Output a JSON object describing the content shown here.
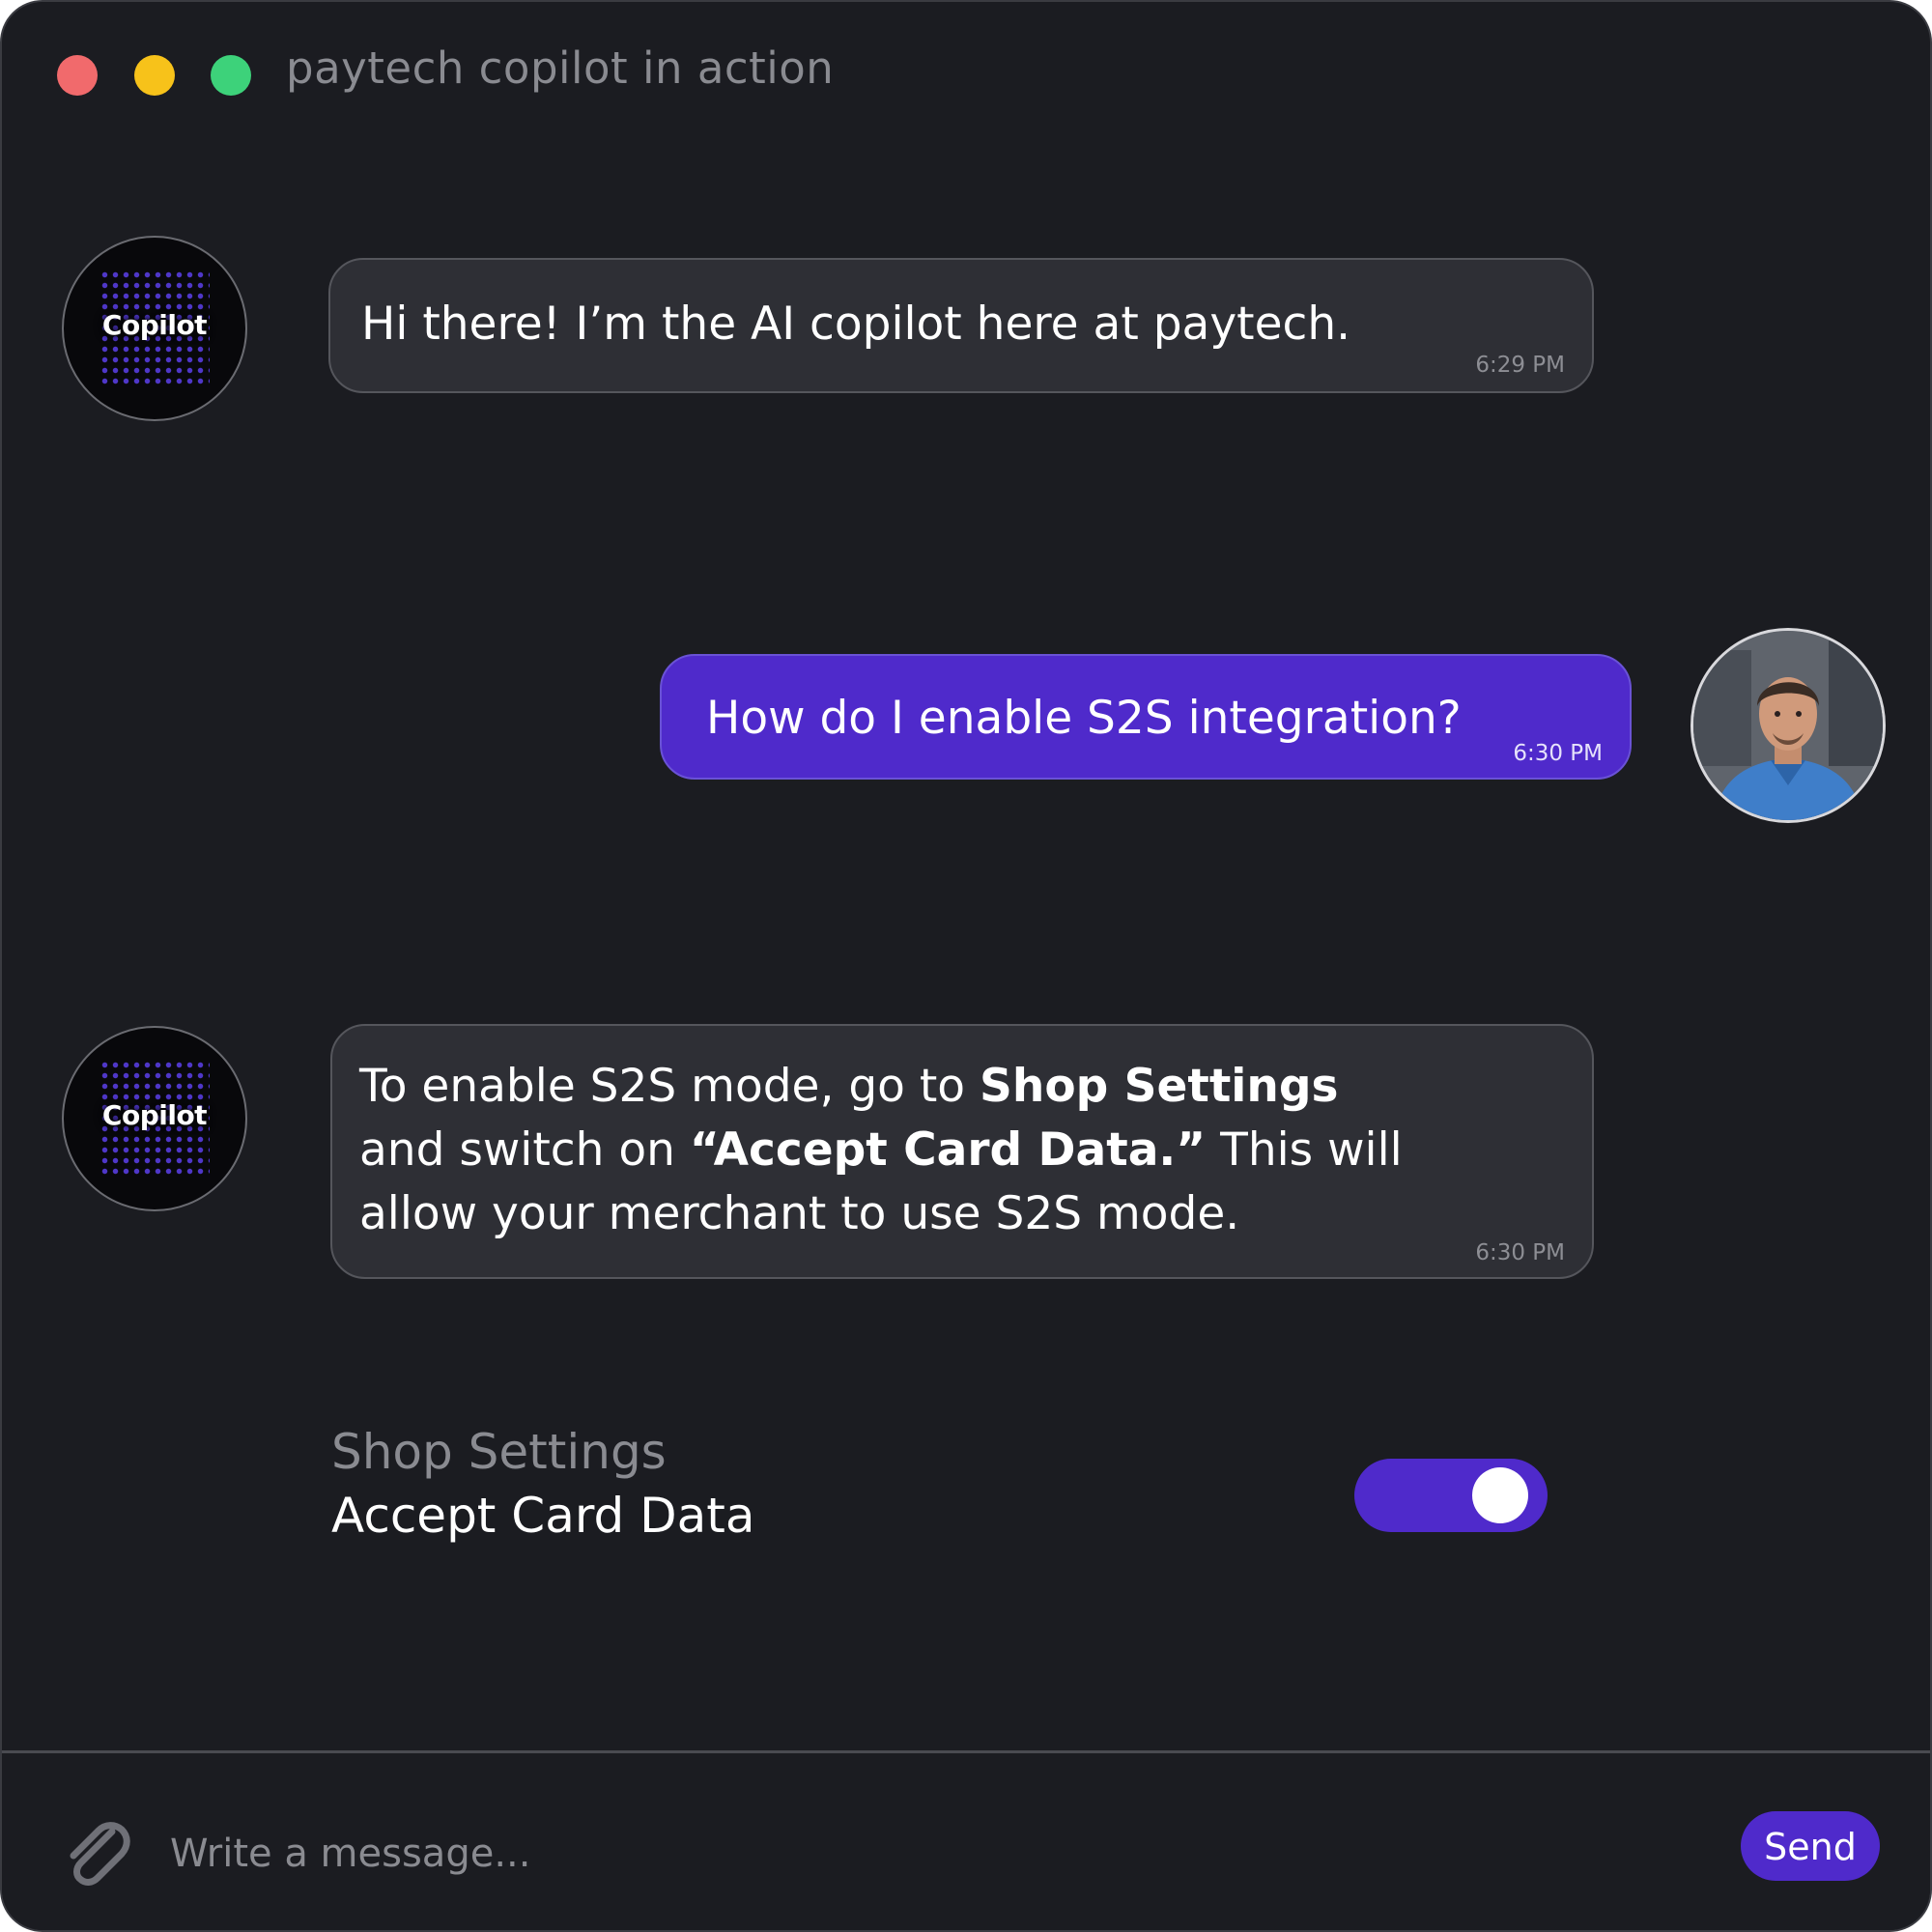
{
  "window": {
    "title": "paytech copilot in action"
  },
  "bot": {
    "avatar_label": "Copilot"
  },
  "messages": [
    {
      "sender": "bot",
      "text": "Hi there! I’m the AI copilot here at paytech.",
      "time": "6:29 PM"
    },
    {
      "sender": "user",
      "text": "How do I enable S2S integration?",
      "time": "6:30 PM"
    },
    {
      "sender": "bot",
      "parts": [
        "To enable S2S mode, go to ",
        "Shop Settings",
        "and switch on ",
        "“Accept Card Data.”",
        " This will",
        "allow your merchant to use S2S mode."
      ],
      "time": "6:30 PM"
    }
  ],
  "setting": {
    "section": "Shop Settings",
    "label": "Accept Card Data",
    "enabled": true
  },
  "composer": {
    "placeholder": "Write a message...",
    "send_label": "Send"
  },
  "colors": {
    "accent": "#4f2acb",
    "background": "#1b1c21",
    "bot_bubble": "#2e2f35"
  }
}
